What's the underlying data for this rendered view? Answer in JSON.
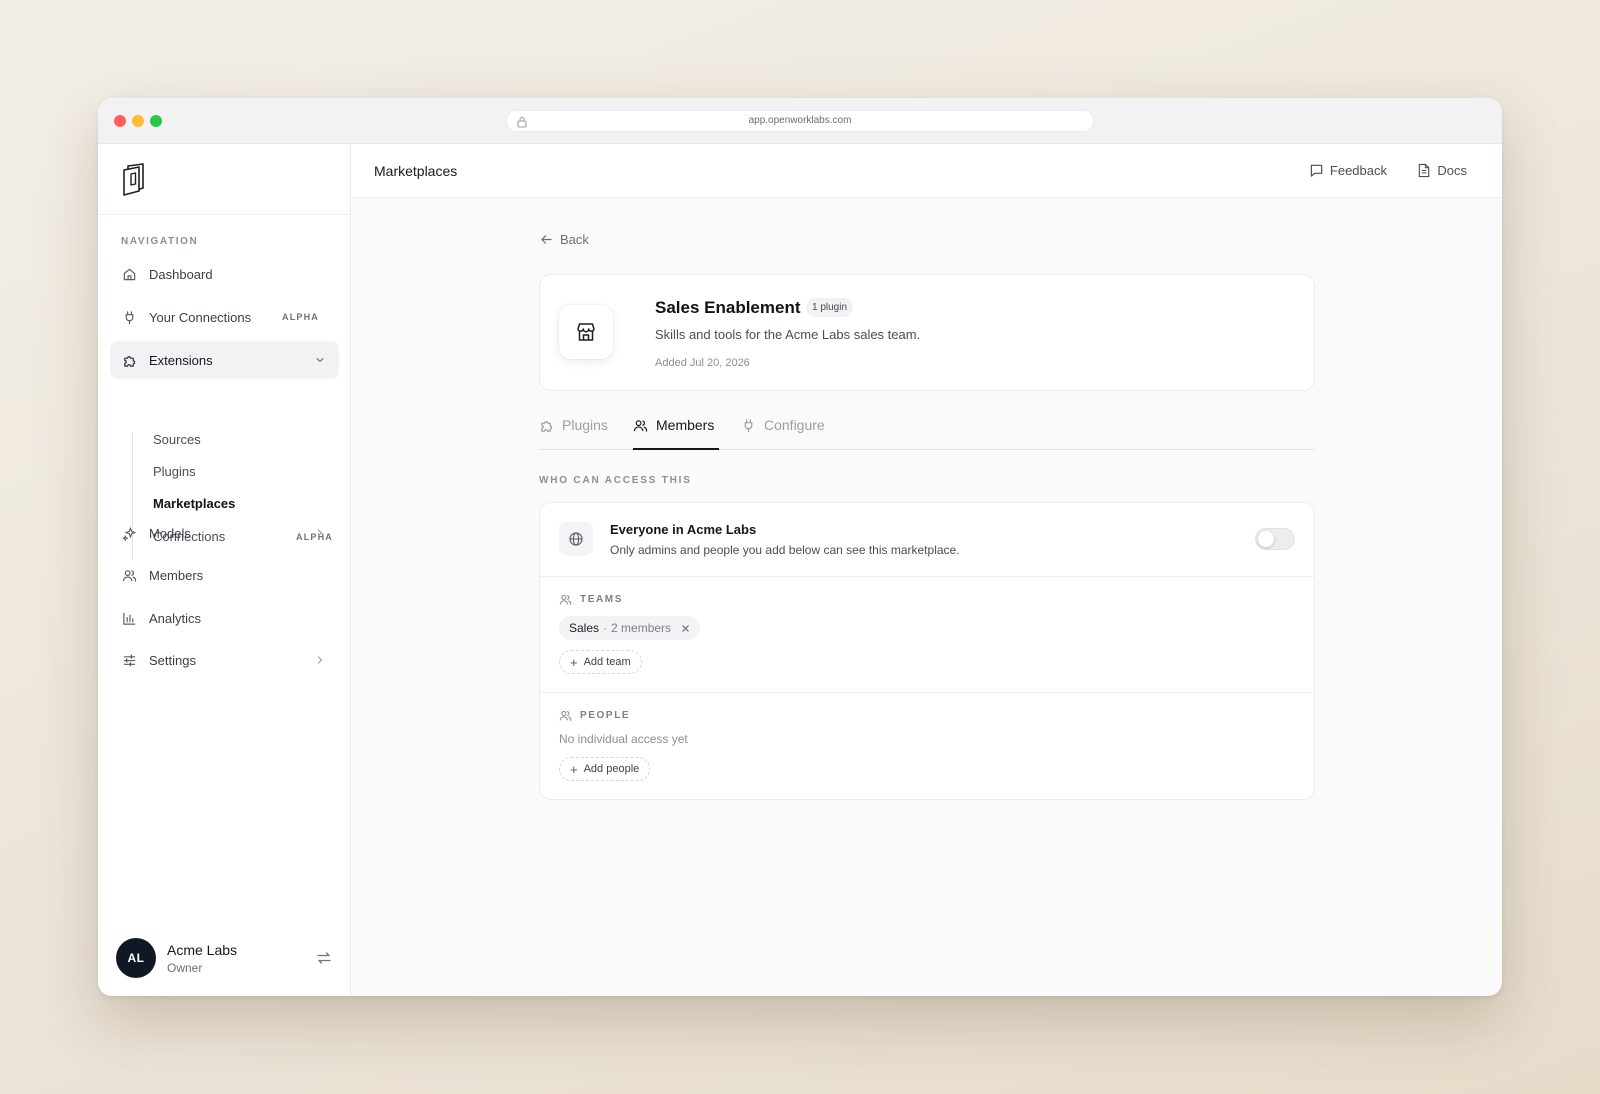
{
  "browser": {
    "url": "app.openworklabs.com"
  },
  "sidebar": {
    "nav_heading": "NAVIGATION",
    "items": [
      {
        "label": "Dashboard",
        "icon": "home-icon"
      },
      {
        "label": "Your Connections",
        "icon": "plug-icon",
        "badge": "ALPHA"
      },
      {
        "label": "Extensions",
        "icon": "puzzle-icon",
        "expanded": true
      },
      {
        "label": "Models",
        "icon": "sparkles-icon"
      },
      {
        "label": "Members",
        "icon": "users-icon"
      },
      {
        "label": "Analytics",
        "icon": "bar-chart-icon"
      },
      {
        "label": "Settings",
        "icon": "sliders-icon"
      }
    ],
    "subitems": [
      {
        "label": "Sources"
      },
      {
        "label": "Plugins"
      },
      {
        "label": "Marketplaces",
        "active": true
      },
      {
        "label": "Connections",
        "badge": "ALPHA"
      }
    ],
    "user": {
      "initials": "AL",
      "name": "Acme Labs",
      "role": "Owner"
    }
  },
  "header": {
    "title": "Marketplaces",
    "feedback_label": "Feedback",
    "docs_label": "Docs"
  },
  "main": {
    "back_label": "Back",
    "marketplace": {
      "name": "Sales Enablement",
      "plugin_count": "1 plugin",
      "description": "Skills and tools for the Acme Labs sales team.",
      "added": "Added Jul 20, 2026"
    },
    "tabs": [
      {
        "label": "Plugins",
        "icon": "puzzle-icon"
      },
      {
        "label": "Members",
        "icon": "users-icon",
        "active": true
      },
      {
        "label": "Configure",
        "icon": "plug-icon"
      }
    ],
    "access": {
      "section_label": "WHO CAN ACCESS THIS",
      "everyone_title": "Everyone in Acme Labs",
      "everyone_desc": "Only admins and people you add below can see this marketplace.",
      "everyone_enabled": false,
      "teams_label": "TEAMS",
      "teams": [
        {
          "name": "Sales",
          "sep": "·",
          "count": "2 members"
        }
      ],
      "add_team_label": "Add team",
      "people_label": "PEOPLE",
      "people_empty": "No individual access yet",
      "add_people_label": "Add people"
    }
  },
  "colors": {
    "accent_dark": "#15181c",
    "avatar_bg": "#101826",
    "close_red": "#ff5f57",
    "min_yellow": "#febc2e",
    "max_green": "#28c840"
  }
}
